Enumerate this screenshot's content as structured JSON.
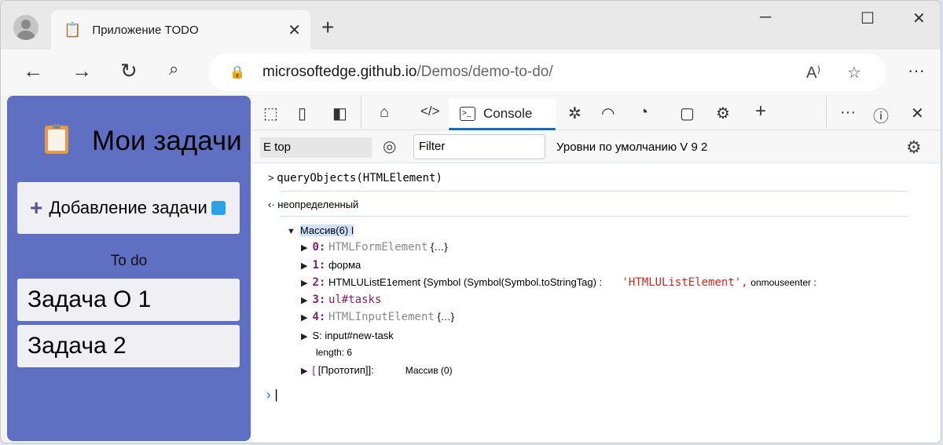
{
  "browser": {
    "tab_title": "Приложение TODO",
    "url_host": "microsoftedge.github.io",
    "url_path": "/Demos/demo-to-do/"
  },
  "app": {
    "title": "Мои задачи",
    "add_button": "Добавление задачи",
    "section": "To do",
    "tasks": [
      "Задача О 1",
      "Задача 2"
    ]
  },
  "devtools": {
    "console_tab": "Console",
    "context": "E top",
    "filter_placeholder": "Filter",
    "levels": "Уровни по умолчанию V 9 2",
    "input": "queryObjects(HTMLElement)",
    "result": "неопределенный",
    "array_label": "Массив(6) I",
    "items": [
      {
        "index": "0:",
        "text": "HTMLFormElement",
        "suffix": "{…}"
      },
      {
        "index": "1:",
        "text": "форма"
      },
      {
        "index": "2:",
        "text": "HTMLUListE1ement {Symbol (Symbol(Symbol.toStringTag) :",
        "string": "'HTMLUListElement',",
        "extra": "onmouseenter :"
      },
      {
        "index": "3:",
        "text": "ul#tasks"
      },
      {
        "index": "4:",
        "text": "HTMLInputElement",
        "suffix": "{…}"
      },
      {
        "index": "",
        "text": "S: input#new-task"
      }
    ],
    "length": "length: 6",
    "proto_bracket": "[",
    "proto_label": "[Прототип]]:",
    "proto_value": "Массив (0)"
  }
}
